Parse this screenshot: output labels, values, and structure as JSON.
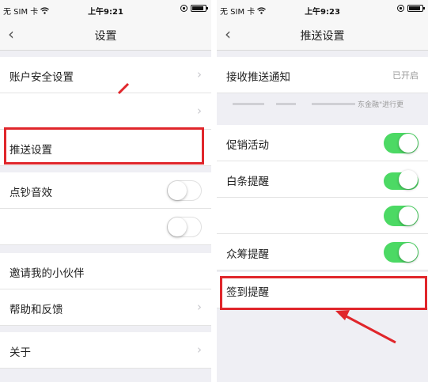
{
  "status_bar": {
    "carrier": "无 SIM 卡",
    "left_time": "上午9:21",
    "right_time": "上午9:23"
  },
  "left_screen": {
    "title": "设置",
    "back_icon": "chevron-left",
    "rows": {
      "account_security": "账户安全设置",
      "push_settings": "推送设置",
      "coin_sound": "点钞音效",
      "invite": "邀请我的小伙伴",
      "help": "帮助和反馈",
      "about": "关于"
    },
    "toggles": {
      "coin_sound": false,
      "unnamed": false
    }
  },
  "right_screen": {
    "title": "推送设置",
    "back_icon": "chevron-left",
    "receive_push_label": "接收推送通知",
    "receive_push_value": "已开启",
    "note_partial": "东金融\"进行更",
    "rows": {
      "promotions": "促销活动",
      "baitiao_reminder": "白条提醒",
      "crowdfunding_reminder": "众筹提醒",
      "checkin_reminder": "签到提醒"
    },
    "toggles": {
      "promotions": true,
      "baitiao_reminder": true,
      "unnamed": true,
      "crowdfunding_reminder": true
    }
  },
  "colors": {
    "toggle_on": "#4cd964",
    "highlight_red": "#e0262b",
    "background": "#efeff4"
  }
}
